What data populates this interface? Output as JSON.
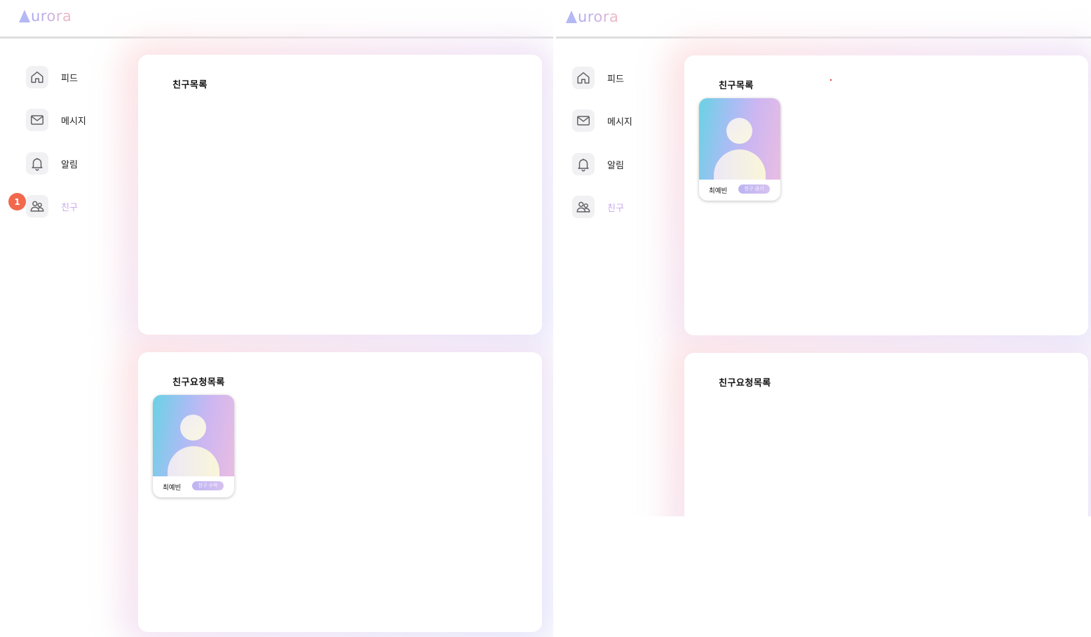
{
  "app": {
    "logo_text": "urora"
  },
  "colors": {
    "accent": "#c9a9ec",
    "badge": "#f2684d",
    "button": "#c5b9f1"
  },
  "left_view": {
    "nav": [
      {
        "label": "피드",
        "icon": "home-icon"
      },
      {
        "label": "메시지",
        "icon": "mail-icon"
      },
      {
        "label": "알림",
        "icon": "bell-icon"
      },
      {
        "label": "친구",
        "icon": "users-icon",
        "active": true
      }
    ],
    "notification_badge": "1",
    "friend_list": {
      "title": "친구목록",
      "friends": []
    },
    "request_list": {
      "title": "친구요청목록",
      "requests": [
        {
          "name": "최예빈",
          "action": "친구 수락"
        }
      ]
    }
  },
  "right_view": {
    "nav": [
      {
        "label": "피드",
        "icon": "home-icon"
      },
      {
        "label": "메시지",
        "icon": "mail-icon"
      },
      {
        "label": "알림",
        "icon": "bell-icon"
      },
      {
        "label": "친구",
        "icon": "users-icon",
        "active": true
      }
    ],
    "friend_list": {
      "title": "친구목록",
      "friends": [
        {
          "name": "최예빈",
          "action": "친구 끊기"
        }
      ]
    },
    "request_list": {
      "title": "친구요청목록",
      "requests": []
    }
  }
}
